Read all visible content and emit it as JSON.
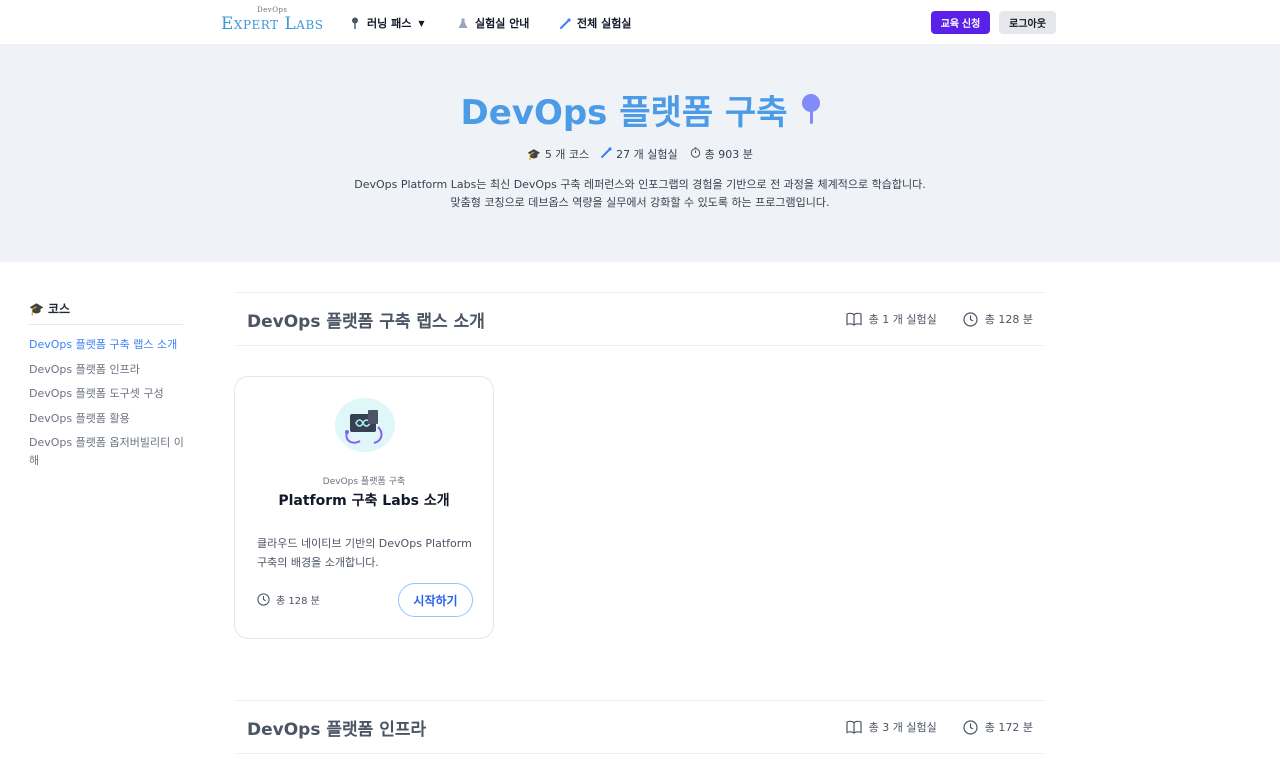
{
  "header": {
    "logo_small": "DevOps",
    "logo_big": "Expert Labs",
    "nav": [
      {
        "label": "러닝 패스",
        "icon": "pin-icon"
      },
      {
        "label": "실험실 안내",
        "icon": "flask-icon"
      },
      {
        "label": "전체 실험실",
        "icon": "pipette-icon"
      }
    ],
    "apply_label": "교육 신청",
    "logout_label": "로그아웃"
  },
  "hero": {
    "title": "DevOps 플랫폼 구축",
    "stats": {
      "courses": "5 개 코스",
      "labs": "27 개 실험실",
      "minutes": "총 903 분"
    },
    "desc_line1": "DevOps Platform Labs는 최신 DevOps 구축 레퍼런스와 인포그랩의 경험을 기반으로 전 과정을 체계적으로 학습합니다.",
    "desc_line2": "맞춤형 코칭으로 데브옵스 역량을 실무에서 강화할 수 있도록 하는 프로그램입니다."
  },
  "sidebar": {
    "title": "코스",
    "items": [
      {
        "label": "DevOps 플랫폼 구축 랩스 소개",
        "active": true
      },
      {
        "label": "DevOps 플랫폼 인프라",
        "active": false
      },
      {
        "label": "DevOps 플랫폼 도구셋 구성",
        "active": false
      },
      {
        "label": "DevOps 플랫폼 활용",
        "active": false
      },
      {
        "label": "DevOps 플랫폼 옵저버빌리티 이해",
        "active": false
      }
    ]
  },
  "sections": [
    {
      "title": "DevOps 플랫폼 구축 랩스 소개",
      "labs": "총 1 개 실험실",
      "minutes": "총 128 분"
    },
    {
      "title": "DevOps 플랫폼 인프라",
      "labs": "총 3 개 실험실",
      "minutes": "총 172 분"
    }
  ],
  "card": {
    "category": "DevOps 플랫폼 구축",
    "title": "Platform 구축 Labs 소개",
    "desc": "클라우드 네이티브 기반의 DevOps Platform 구축의 배경을 소개합니다.",
    "time": "총 128 분",
    "button": "시작하기"
  },
  "colors": {
    "accent": "#5b21e8",
    "title_blue": "#4b9be6",
    "link_blue": "#3b82f6"
  }
}
